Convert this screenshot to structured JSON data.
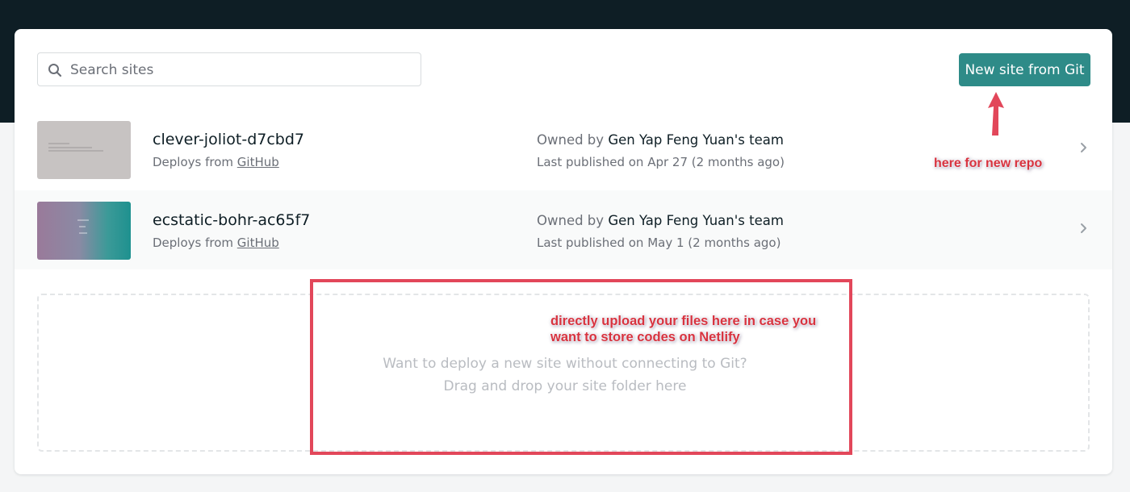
{
  "search": {
    "placeholder": "Search sites",
    "value": ""
  },
  "toolbar": {
    "new_site_label": "New site from Git"
  },
  "sites": [
    {
      "name": "clever-joliot-d7cbd7",
      "deploys_prefix": "Deploys from",
      "deploys_source": "GitHub",
      "owner_prefix": "Owned by",
      "owner": "Gen Yap Feng Yuan's team",
      "published": "Last published on Apr 27 (2 months ago)"
    },
    {
      "name": "ecstatic-bohr-ac65f7",
      "deploys_prefix": "Deploys from",
      "deploys_source": "GitHub",
      "owner_prefix": "Owned by",
      "owner": "Gen Yap Feng Yuan's team",
      "published": "Last published on May 1 (2 months ago)"
    }
  ],
  "dropzone": {
    "line1": "Want to deploy a new site without connecting to Git?",
    "line2": "Drag and drop your site folder here"
  },
  "annotations": {
    "new_repo": "here for new repo",
    "upload_line1": "directly upload your files here in case you",
    "upload_line2": "want to store codes on Netlify"
  },
  "colors": {
    "header": "#0e1e25",
    "accent": "#2e8b88",
    "annotation": "#e2475a"
  },
  "icons": {
    "search": "search-icon",
    "chevron": "chevron-right-icon",
    "arrow": "arrow-up-icon"
  }
}
